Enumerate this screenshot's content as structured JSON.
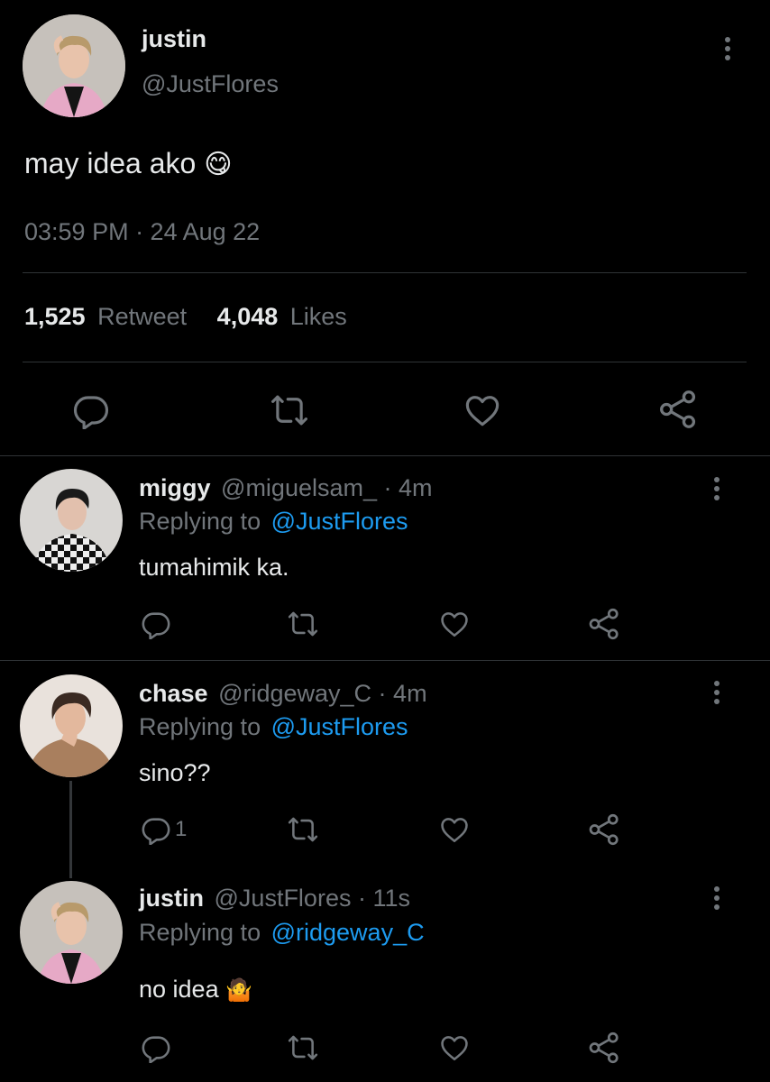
{
  "main_tweet": {
    "name": "justin",
    "handle": "@JustFlores",
    "text": "may idea ako",
    "emoji": "😋",
    "timestamp": "03:59 PM · 24 Aug 22",
    "retweet_count": "1,525",
    "retweet_label": "Retweet",
    "like_count": "4,048",
    "like_label": "Likes"
  },
  "replies": [
    {
      "name": "miggy",
      "meta": "@miguelsam_ · 4m",
      "replying_label": "Replying to",
      "replying_to": "@JustFlores",
      "text": "tumahimik ka."
    },
    {
      "name": "chase",
      "meta": "@ridgeway_C · 4m",
      "replying_label": "Replying to",
      "replying_to": "@JustFlores",
      "text": "sino??",
      "reply_count": "1"
    },
    {
      "name": "justin",
      "meta": "@JustFlores · 11s",
      "replying_label": "Replying to",
      "replying_to": "@ridgeway_C",
      "text": "no idea",
      "emoji": "🤷"
    }
  ],
  "colors": {
    "background": "#000000",
    "text": "#e7e9ea",
    "secondary": "#71767b",
    "link": "#1d9bf0",
    "divider": "#2f3336"
  }
}
